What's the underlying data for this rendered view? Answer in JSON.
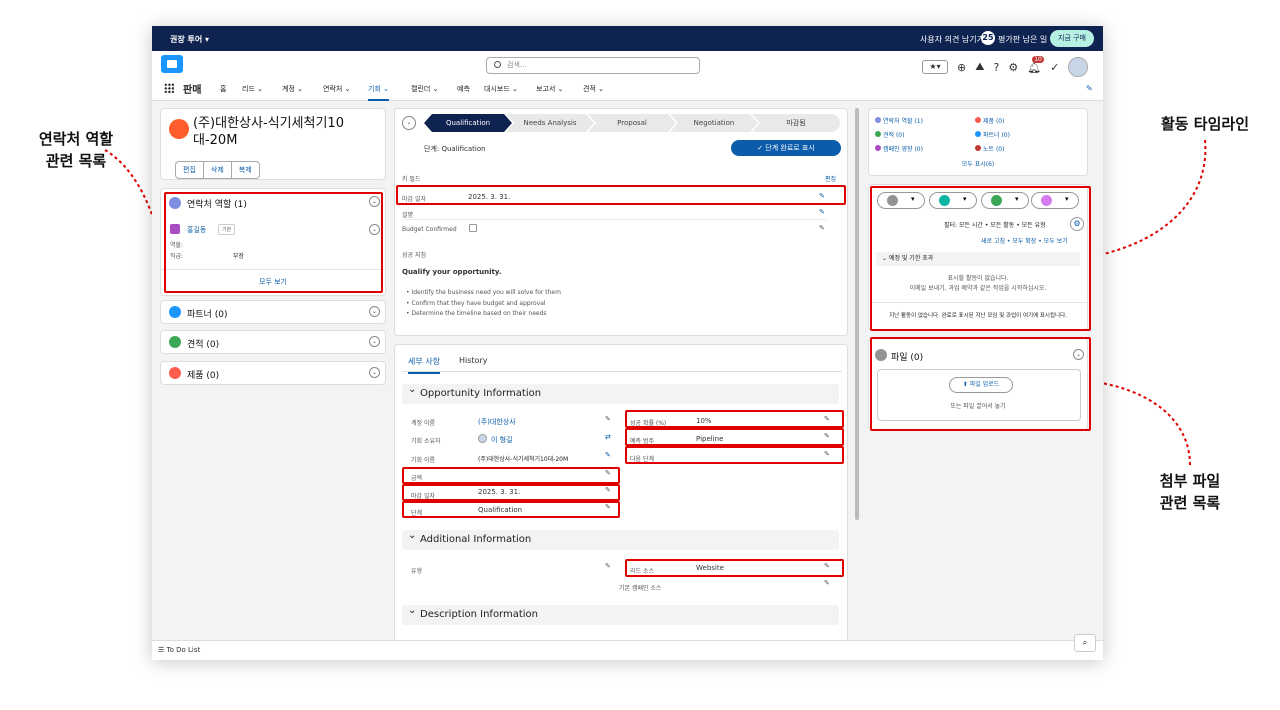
{
  "callouts": {
    "contacts": "연락처 역할\n관련 목록",
    "timeline": "활동 타임라인",
    "files": "첨부 파일\n관련 목록"
  },
  "topbar": {
    "tour": "권장 투어 ▾",
    "feedback": "사용자 의견 남기기",
    "days_count": "25",
    "days_label": "평가판 남은 일 수",
    "buy": "지금 구매"
  },
  "header": {
    "search_placeholder": "검색...",
    "notif_count": "10"
  },
  "nav": {
    "app": "판매",
    "items": [
      "홈",
      "리드 ⌄",
      "계정 ⌄",
      "연락처 ⌄",
      "기회 ⌄",
      "캘린더 ⌄",
      "예측",
      "대시보드 ⌄",
      "보고서 ⌄",
      "견적 ⌄"
    ]
  },
  "record": {
    "title": "(주)대한상사-식기세척기10 대-20M",
    "buttons": [
      "편집",
      "삭제",
      "복제"
    ]
  },
  "contact_roles": {
    "title": "연락처 역할 (1)",
    "name": "홍길동",
    "tag": "기본",
    "role_label": "역할:",
    "title_label": "직급:",
    "title_value": "부장",
    "view_all": "모두 보기"
  },
  "related_left": [
    "파트너 (0)",
    "견적 (0)",
    "제품 (0)"
  ],
  "path": {
    "stages": [
      "Qualification",
      "Needs Analysis",
      "Proposal",
      "Negotiation",
      "마감됨"
    ],
    "stage_text": "단계: Qualification",
    "complete_button": "✓ 단계 완료로 표시"
  },
  "key_fields": {
    "title": "키 필드",
    "edit": "편집",
    "rows": [
      {
        "label": "마감 일자",
        "value": "2025. 3. 31."
      },
      {
        "label": "설명",
        "value": ""
      },
      {
        "label": "Budget Confirmed",
        "value": ""
      }
    ]
  },
  "guidance": {
    "title": "성공 지침",
    "heading": "Qualify your opportunity.",
    "bullets": [
      "Identify the business need you will solve for them",
      "Confirm that they have budget and approval",
      "Determine the timeline based on their needs"
    ]
  },
  "tabs": [
    "세부 사항",
    "History"
  ],
  "opp_info": {
    "title": "Opportunity Information",
    "left": [
      {
        "label": "계정 이름",
        "value": "(주)대한상사"
      },
      {
        "label": "기회 소유자",
        "value": "이 형길"
      },
      {
        "label": "기회 이름",
        "value": "(주)대한상사-식기세척기10대-20M"
      },
      {
        "label": "금액",
        "value": ""
      },
      {
        "label": "마감 일자",
        "value": "2025. 3. 31."
      },
      {
        "label": "단계",
        "value": "Qualification"
      }
    ],
    "right": [
      {
        "label": "성공 확률 (%)",
        "value": "10%"
      },
      {
        "label": "예측 범주",
        "value": "Pipeline"
      },
      {
        "label": "다음 단계",
        "value": ""
      }
    ]
  },
  "add_info": {
    "title": "Additional Information",
    "left": [
      {
        "label": "유형",
        "value": ""
      }
    ],
    "right": [
      {
        "label": "리드 소스",
        "value": "Website"
      },
      {
        "label": "기본 캠페인 소스",
        "value": ""
      }
    ]
  },
  "desc_info": {
    "title": "Description Information"
  },
  "related_right": {
    "items": [
      "연락처 역할 (1)",
      "제품 (0)",
      "견적 (0)",
      "파트너 (0)",
      "캠페인 영향 (0)",
      "노트 (0)"
    ],
    "show_all": "모두 표시(6)"
  },
  "activity": {
    "filter": "필터: 모든 시간 • 모든 활동 • 모든 유형",
    "links": "새로 고침 • 모두 확장 • 모두 보기",
    "upcoming": "예정 및 기한 초과",
    "empty1": "표시할 활동이 없습니다.",
    "empty2": "이메일 보내기, 과업 예약과 같은 작업을 시작하십시오.",
    "past": "지난 활동이 없습니다. 완료로 표시된 지난 모임 및 과업이 여기에 표시됩니다."
  },
  "files": {
    "title": "파일 (0)",
    "upload": "파일 업로드",
    "drop": "또는 파일 끌어서 놓기"
  },
  "footer": {
    "todo": "To Do List"
  },
  "colors": {
    "navy": "#0f2351",
    "brand": "#0b5cab",
    "highlight": "#e00000",
    "path_active": "#0f2351"
  }
}
